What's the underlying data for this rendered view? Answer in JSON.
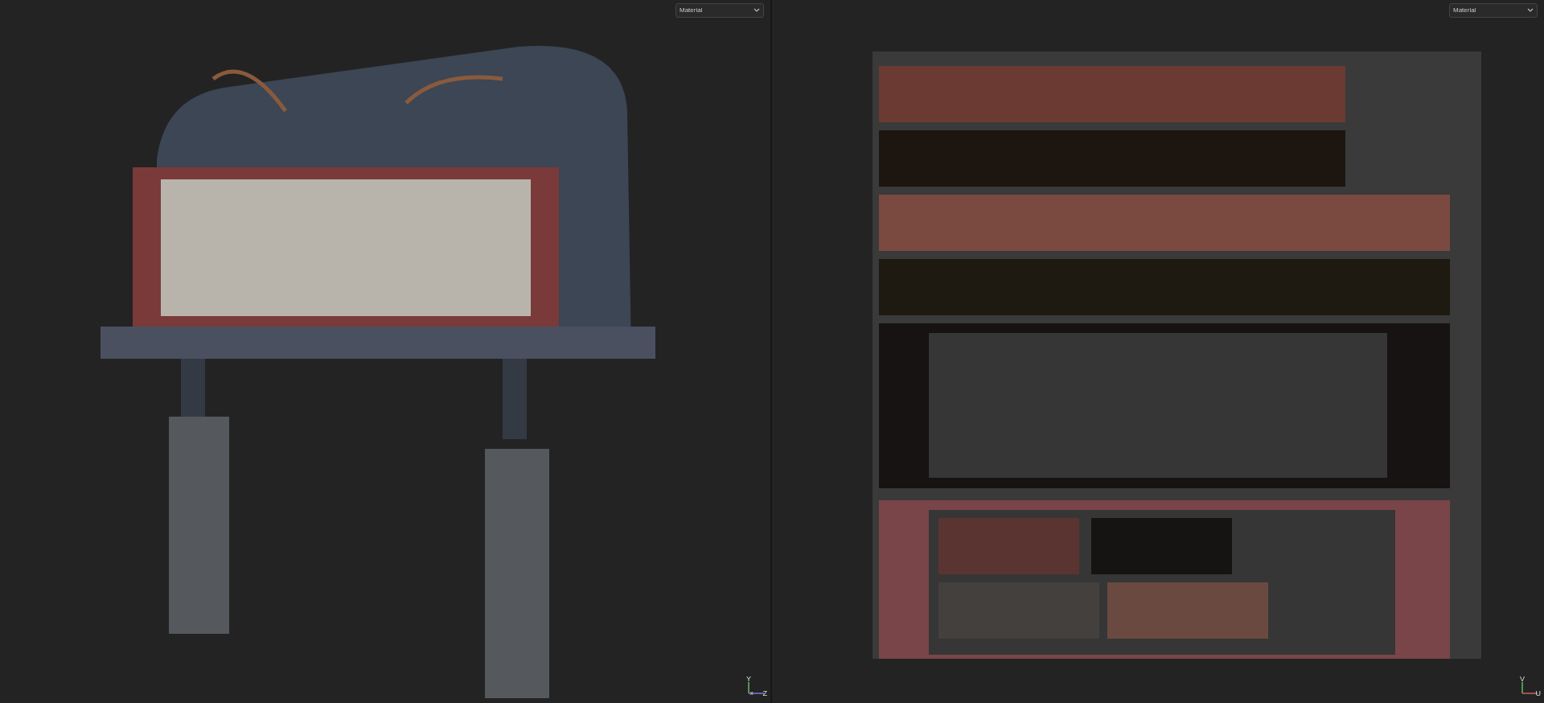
{
  "viewports": [
    {
      "kind": "perspective",
      "channel_select": {
        "value": "Material"
      },
      "axis_gizmo": {
        "vertical": "Y",
        "depth": "x",
        "horizontal": "Z"
      }
    },
    {
      "kind": "uv",
      "channel_select": {
        "value": "Material"
      },
      "axis_gizmo": {
        "vertical": "V",
        "horizontal": "U"
      }
    }
  ]
}
